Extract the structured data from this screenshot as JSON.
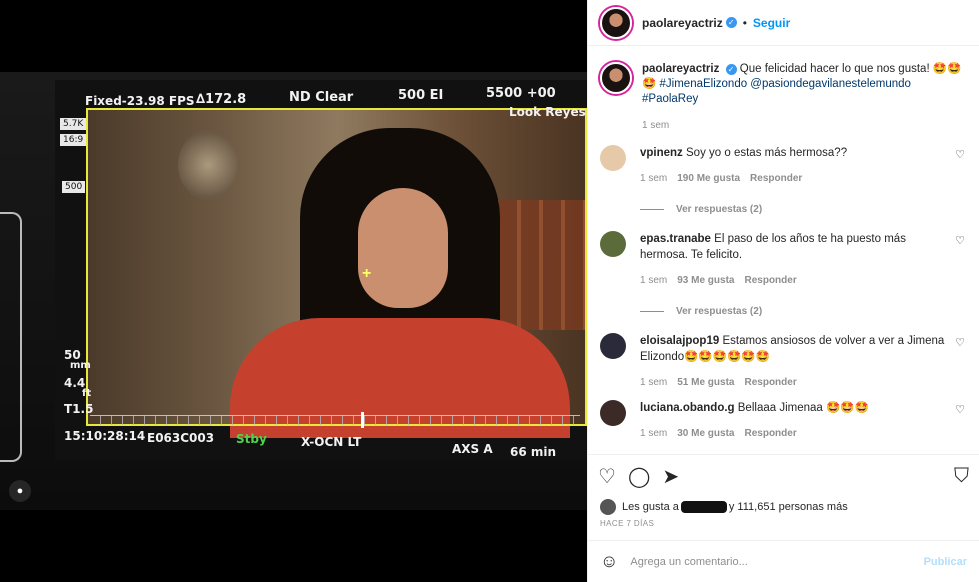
{
  "hud": {
    "fps": "Fixed-23.98 FPS",
    "shutter": "∆172.8",
    "nd": "ND Clear",
    "ei": "500 EI",
    "wb": "5500 +00",
    "look": "Look Reyes I",
    "res": "5.7K",
    "aspect": "16:9",
    "iso_chip": "500",
    "lens_mm": "50",
    "lens_unit": "mm",
    "focus": "4.4",
    "focus_unit": "ft",
    "stop": "T1.5",
    "timecode": "15:10:28:14",
    "clip": "E063C003",
    "status": "Stby",
    "codec": "X-OCN LT",
    "media": "AXS A",
    "remaining": "66 min"
  },
  "header": {
    "username": "paolareyactriz",
    "follow": "Seguir"
  },
  "caption": {
    "username": "paolareyactriz",
    "text": "Que felicidad hacer lo que nos gusta! 🤩🤩🤩",
    "tags": "#JimenaElizondo @pasiondegavilanestelemundo #PaolaRey",
    "time": "1 sem"
  },
  "comments": [
    {
      "user": "vpinenz",
      "text": "Soy yo o estas más hermosa??",
      "time": "1 sem",
      "likes": "190 Me gusta",
      "reply": "Responder",
      "replies": "Ver respuestas (2)",
      "avatar": "#e6c9a8"
    },
    {
      "user": "epas.tranabe",
      "text": "El paso de los años te ha puesto más hermosa. Te felicito.",
      "time": "1 sem",
      "likes": "93 Me gusta",
      "reply": "Responder",
      "replies": "Ver respuestas (2)",
      "avatar": "#5b6b3a"
    },
    {
      "user": "eloisalajpop19",
      "text": "Estamos ansiosos de volver a ver a Jimena Elizondo🤩🤩🤩🤩🤩🤩",
      "time": "1 sem",
      "likes": "51 Me gusta",
      "reply": "Responder",
      "avatar": "#2a2a3a"
    },
    {
      "user": "luciana.obando.g",
      "text": "Bellaaa Jimenaa 🤩🤩🤩",
      "time": "1 sem",
      "likes": "30 Me gusta",
      "reply": "Responder",
      "avatar": "#3b2a26"
    }
  ],
  "likes": {
    "prefix": "Les gusta a",
    "suffix": "y 111,651 personas más"
  },
  "ago": "HACE 7 DÍAS",
  "add_comment": {
    "placeholder": "Agrega un comentario...",
    "publish": "Publicar"
  },
  "colors": {
    "accent": "#0095f6",
    "hud_yellow": "#e8e83a"
  }
}
